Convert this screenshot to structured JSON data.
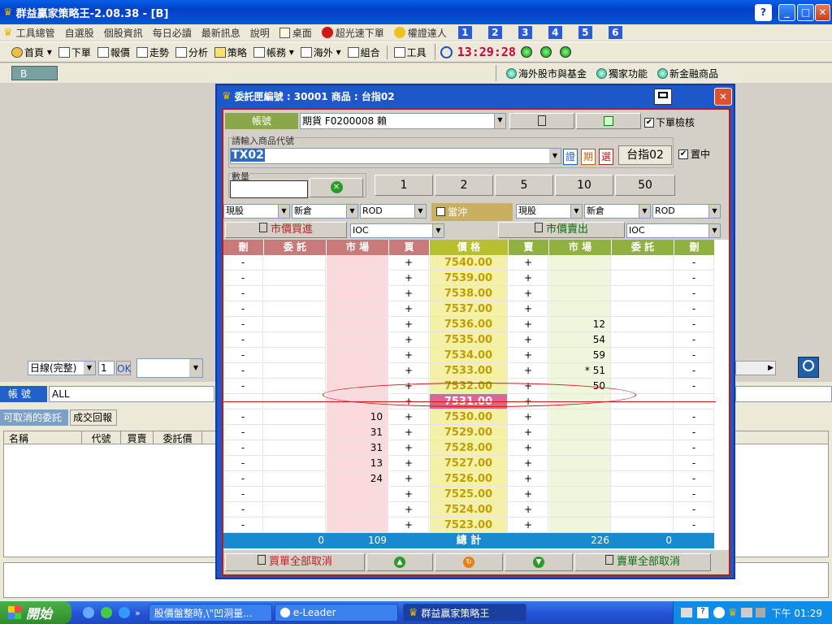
{
  "app": {
    "title": "群益贏家策略王-2.08.38 - [B]"
  },
  "menubar": {
    "items": [
      "工具總管",
      "自選股",
      "個股資訊",
      "每日必讀",
      "最新訊息",
      "說明",
      "桌面",
      "超光速下單",
      "權證達人"
    ],
    "numbers": [
      "1",
      "2",
      "3",
      "4",
      "5",
      "6"
    ]
  },
  "toolbar": {
    "items": [
      "首頁",
      "下單",
      "報價",
      "走勢",
      "分析",
      "策略",
      "帳務",
      "海外",
      "組合",
      "工具"
    ],
    "clock": "13:29:28"
  },
  "tabrow": {
    "tab": "B",
    "links": [
      "海外股市與基金",
      "獨家功能",
      "新金融商品"
    ]
  },
  "chartctl": {
    "period": "日線(完整)",
    "num": "1",
    "ok": "OK"
  },
  "lower": {
    "account_label": "帳 號",
    "account_value": "ALL",
    "tabs": [
      "可取消的委託",
      "成交回報"
    ],
    "cols": [
      "名稱",
      "代號",
      "買賣",
      "委託價"
    ]
  },
  "dialog": {
    "title": "委託匣編號 : 30001 商品 : 台指02",
    "account_label": "帳號",
    "account_value": "期貨 F0200008        賴",
    "check_label": "下單檢核",
    "code_label": "請輸入商品代號",
    "code_value": "TX02",
    "chips": [
      "證",
      "期",
      "選"
    ],
    "product_name": "台指02",
    "center_label": "置中",
    "qty_label": "數量",
    "qty_buttons": [
      "1",
      "2",
      "5",
      "10",
      "50"
    ],
    "left_opts": [
      "現股",
      "新倉",
      "ROD"
    ],
    "right_opts": [
      "現股",
      "新倉",
      "ROD"
    ],
    "daytrade_label": "當沖",
    "market_buy": "市價買進",
    "market_sell": "市價賣出",
    "ioc": "IOC",
    "headers": [
      "刪",
      "委 託",
      "市 場",
      "買",
      "價 格",
      "賣",
      "市 場",
      "委 託",
      "刪"
    ],
    "rows": [
      {
        "price": "7540.00",
        "buy_mkt": "",
        "sell_mkt": ""
      },
      {
        "price": "7539.00",
        "buy_mkt": "",
        "sell_mkt": ""
      },
      {
        "price": "7538.00",
        "buy_mkt": "",
        "sell_mkt": ""
      },
      {
        "price": "7537.00",
        "buy_mkt": "",
        "sell_mkt": ""
      },
      {
        "price": "7536.00",
        "buy_mkt": "",
        "sell_mkt": "12"
      },
      {
        "price": "7535.00",
        "buy_mkt": "",
        "sell_mkt": "54"
      },
      {
        "price": "7534.00",
        "buy_mkt": "",
        "sell_mkt": "59"
      },
      {
        "price": "7533.00",
        "buy_mkt": "",
        "sell_mkt": "* 51"
      },
      {
        "price": "7532.00",
        "buy_mkt": "",
        "sell_mkt": "50"
      },
      {
        "price": "7531.00",
        "buy_mkt": "",
        "sell_mkt": ""
      },
      {
        "price": "7530.00",
        "buy_mkt": "10",
        "sell_mkt": ""
      },
      {
        "price": "7529.00",
        "buy_mkt": "31",
        "sell_mkt": ""
      },
      {
        "price": "7528.00",
        "buy_mkt": "31",
        "sell_mkt": ""
      },
      {
        "price": "7527.00",
        "buy_mkt": "13",
        "sell_mkt": ""
      },
      {
        "price": "7526.00",
        "buy_mkt": "24",
        "sell_mkt": ""
      },
      {
        "price": "7525.00",
        "buy_mkt": "",
        "sell_mkt": ""
      },
      {
        "price": "7524.00",
        "buy_mkt": "",
        "sell_mkt": ""
      },
      {
        "price": "7523.00",
        "buy_mkt": "",
        "sell_mkt": ""
      }
    ],
    "dash": "-",
    "plus": "+",
    "totals": {
      "buy_order": "0",
      "buy_mkt": "109",
      "label": "總 計",
      "sell_mkt": "226",
      "sell_order": "0"
    },
    "cancel_buy": "買單全部取消",
    "cancel_sell": "賣單全部取消"
  },
  "taskbar": {
    "start": "開始",
    "tasks": [
      "股價盤整時,\\\"凹洞量...",
      "e-Leader",
      "群益贏家策略王"
    ],
    "time": "下午 01:29"
  },
  "colors": {
    "title_blue": "#0a5fe8",
    "header_red": "#c87a7a",
    "price_yellow": "#e0d878",
    "total_blue": "#1a8ad0",
    "current_price": "#d86890"
  }
}
